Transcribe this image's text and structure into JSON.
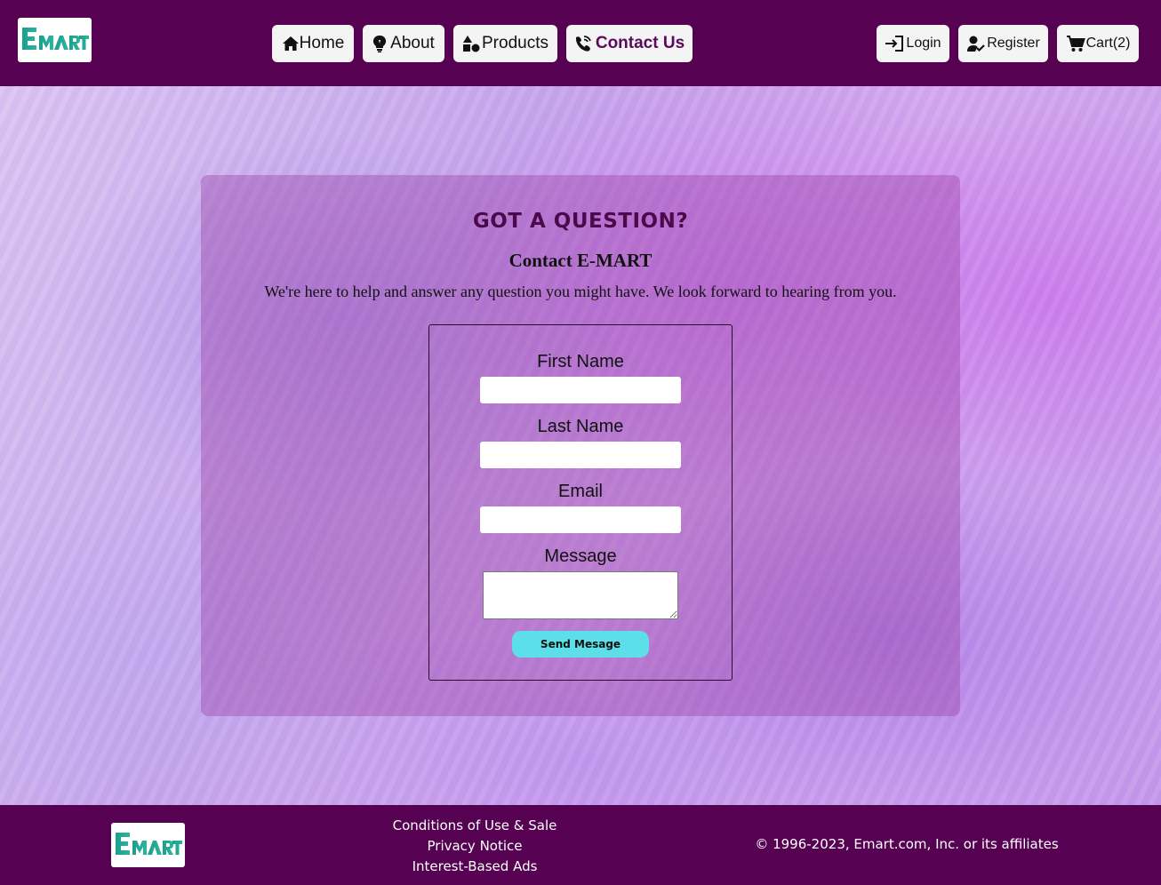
{
  "brand": {
    "logo_text": "EMART",
    "primary_color": "#560152",
    "logo_color": "#1aa08e"
  },
  "nav": {
    "home": "Home",
    "about": "About",
    "products": "Products",
    "contact": "Contact Us",
    "login": "Login",
    "register": "Register",
    "cart": "Cart(2)"
  },
  "contact": {
    "title": "GOT A QUESTION?",
    "subtitle": "Contact E-MART",
    "description": "We're here to help and answer any question you might have. We look forward to hearing from you.",
    "first_name_label": "First Name",
    "last_name_label": "Last Name",
    "email_label": "Email",
    "message_label": "Message",
    "first_name_value": "",
    "last_name_value": "",
    "email_value": "",
    "message_value": "",
    "submit_label": "Send Mesage",
    "submit_color": "#5cdfe9"
  },
  "footer": {
    "links": [
      "Conditions of Use & Sale",
      "Privacy Notice",
      "Interest-Based Ads"
    ],
    "copyright": "© 1996-2023, Emart.com, Inc. or its affiliates"
  }
}
